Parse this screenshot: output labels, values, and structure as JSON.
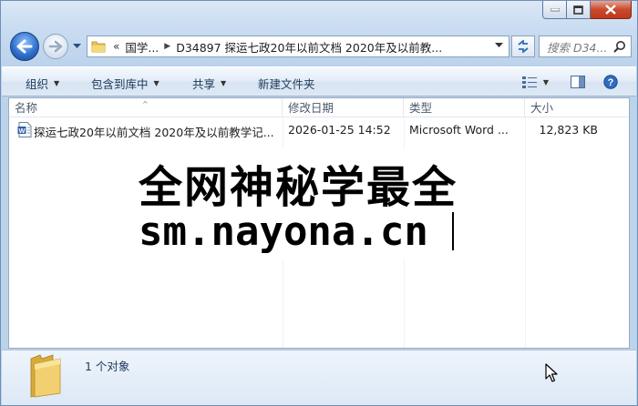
{
  "address": {
    "crumbs": [
      "国学...",
      "D34897 探运七政20年以前文档 2020年及以前教..."
    ],
    "overflow_glyph": "«",
    "search_placeholder": "搜索 D34..."
  },
  "toolbar": {
    "organize": "组织",
    "include_library": "包含到库中",
    "share": "共享",
    "new_folder": "新建文件夹"
  },
  "columns": {
    "name": "名称",
    "modified": "修改日期",
    "type": "类型",
    "size": "大小"
  },
  "files": [
    {
      "name": "探运七政20年以前文档 2020年及以前教学记...",
      "modified": "2026-01-25 14:52",
      "type": "Microsoft Word ...",
      "size": "12,823 KB"
    }
  ],
  "watermark": {
    "line1": "全网神秘学最全",
    "line2": "sm.nayona.cn"
  },
  "status": {
    "object_count": "1 个对象"
  },
  "colors": {
    "window_frame": "#bcd3ec",
    "toolbar_text": "#1e395b",
    "close_button": "#c84a2c"
  }
}
